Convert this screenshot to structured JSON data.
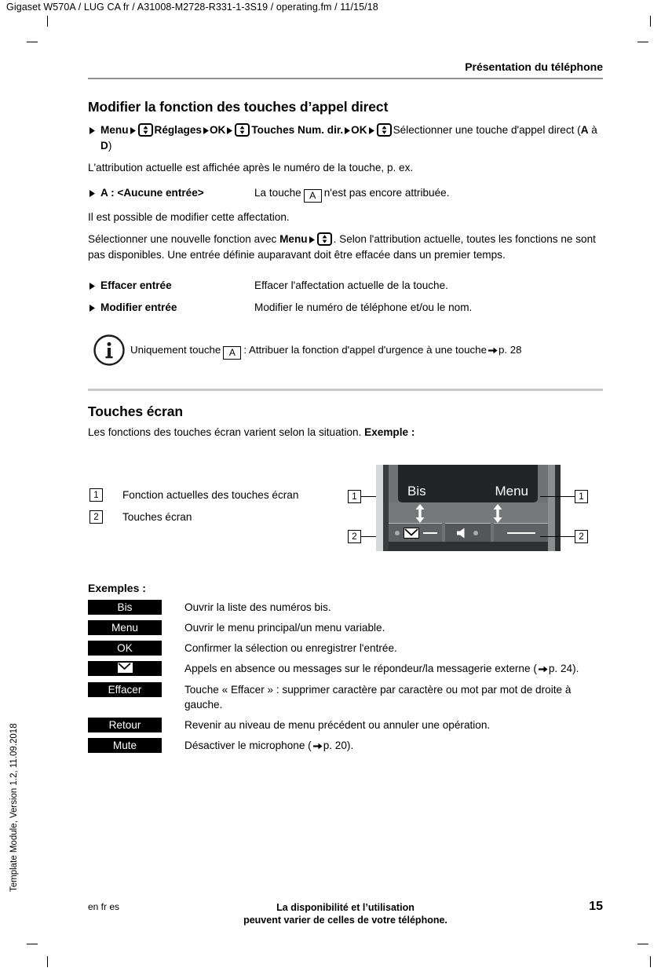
{
  "doc": {
    "identifier": "Gigaset W570A / LUG CA fr / A31008-M2728-R331-1-3S19 / operating.fm / 11/15/18",
    "running_header": "Présentation du téléphone",
    "side_note": "Template Module, Version 1.2, 11.09.2018"
  },
  "section1": {
    "heading": "Modifier la fonction des touches d’appel direct",
    "path": {
      "menu": "Menu",
      "reglages": "Réglages",
      "ok1": "OK",
      "touches": "Touches Num. dir.",
      "ok2": "OK",
      "select_text": "Sélectionner une touche d'appel direct (",
      "range_a": "A",
      "range_mid": " à ",
      "range_d": "D",
      "select_end": ")"
    },
    "intro": "L'attribution actuelle est affichée après le numéro de la touche, p. ex.",
    "example_entry": {
      "term": "A : <Aucune entrée>",
      "desc_before": "La touche",
      "key": "A",
      "desc_after": "n'est pas encore attribuée."
    },
    "para_modify": "Il est possible de modifier cette affectation.",
    "para_select": {
      "before": "Sélectionner une nouvelle fonction avec ",
      "bold_menu": "Menu",
      "after": ". Selon l'attribution actuelle, toutes les fonctions ne sont pas disponibles. Une entrée définie auparavant doit être effacée dans un premier temps."
    },
    "options": [
      {
        "term": "Effacer entrée",
        "desc": "Effacer l'affectation actuelle de la touche."
      },
      {
        "term": "Modifier entrée",
        "desc": "Modifier le numéro de téléphone et/ou le nom."
      }
    ],
    "note": {
      "icon": "info-icon",
      "before": "Uniquement touche",
      "key": "A",
      "middle": ": Attribuer la fonction d'appel d'urgence à une touche",
      "ref": "p. 28"
    }
  },
  "section2": {
    "heading": "Touches écran",
    "intro_before": "Les fonctions des touches écran varient selon la situation. ",
    "intro_bold": "Exemple :",
    "legend": [
      {
        "num": "1",
        "label": "Fonction actuelles des touches écran"
      },
      {
        "num": "2",
        "label": "Touches écran"
      }
    ],
    "phone": {
      "softkey_left": "Bis",
      "softkey_right": "Menu",
      "callout_top_left": "1",
      "callout_top_right": "1",
      "callout_bottom_left": "2",
      "callout_bottom_right": "2",
      "center_key_icon": "speaker-icon",
      "left_key_icon": "envelope-icon",
      "right_key_icon": "dash-icon"
    },
    "examples_title": "Exemples :",
    "examples": [
      {
        "key": "Bis",
        "key_icon": "",
        "desc": "Ouvrir la liste des numéros bis."
      },
      {
        "key": "Menu",
        "key_icon": "",
        "desc": "Ouvrir le menu principal/un menu variable."
      },
      {
        "key": "OK",
        "key_icon": "",
        "desc": "Confirmer la sélection ou enregistrer l'entrée."
      },
      {
        "key": "",
        "key_icon": "envelope-icon",
        "desc": "Appels en absence ou messages sur le répondeur/la messagerie externe (",
        "ref": "p. 24",
        "desc_end": ")."
      },
      {
        "key": "Effacer",
        "key_icon": "",
        "desc": "Touche « Effacer » : supprimer caractère par caractère ou mot par mot de droite à gauche."
      },
      {
        "key": "Retour",
        "key_icon": "",
        "desc": "Revenir au niveau de menu précédent ou annuler une opération."
      },
      {
        "key": "Mute",
        "key_icon": "",
        "desc": "Désactiver le microphone (",
        "ref": "p. 20",
        "desc_end": ")."
      }
    ]
  },
  "footer": {
    "languages": "en fr es",
    "disclaimer_line1": "La disponibilité et l’utilisation",
    "disclaimer_line2": "peuvent varier de celles de votre téléphone.",
    "page_number": "15"
  },
  "colors": {
    "header_rule": "#8f9193",
    "section_rule": "#c8c9cb",
    "key_black": "#000000",
    "phone_body": "#6f7173",
    "phone_screen": "#222426"
  }
}
